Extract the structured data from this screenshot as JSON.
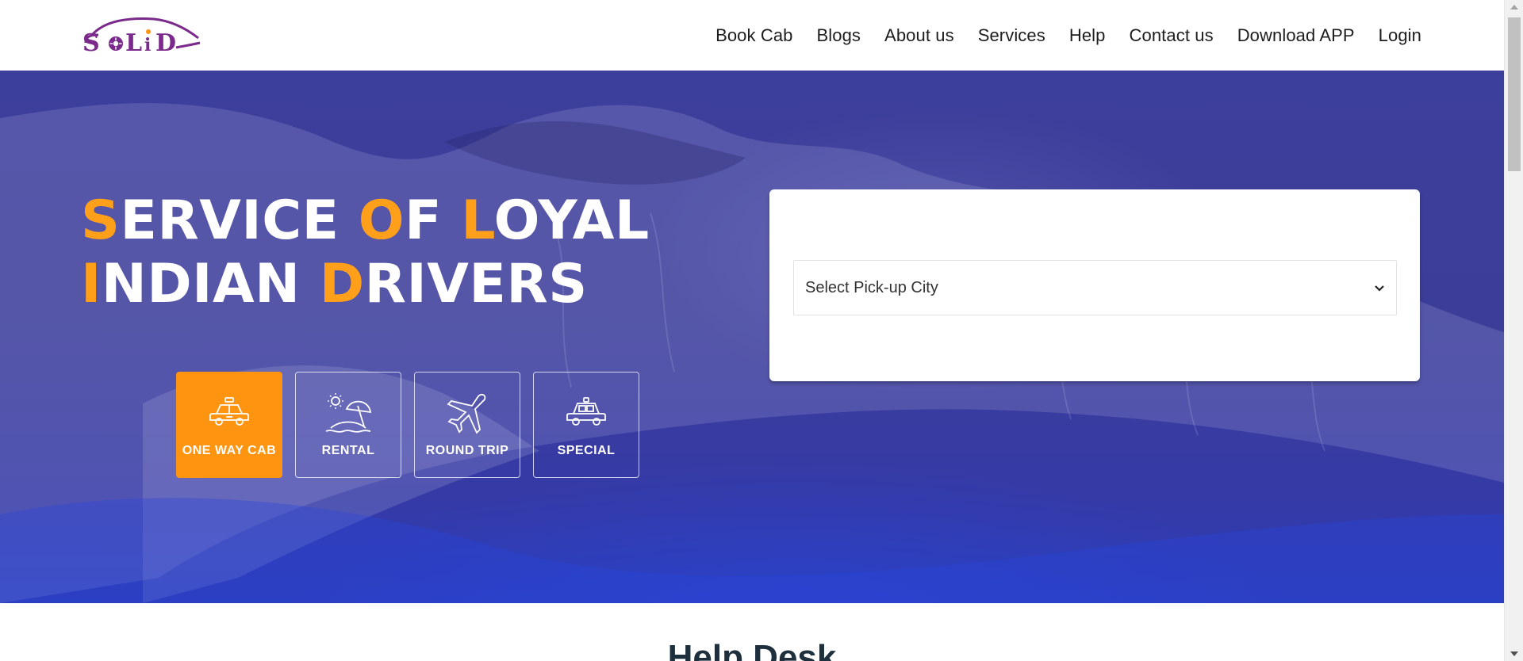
{
  "brand": {
    "logo_text": "SoLiD",
    "accent_color": "#ff9410",
    "brand_purple": "#7a2a8a"
  },
  "nav": {
    "items": [
      {
        "label": "Book Cab"
      },
      {
        "label": "Blogs"
      },
      {
        "label": "About us"
      },
      {
        "label": "Services"
      },
      {
        "label": "Help"
      },
      {
        "label": "Contact us"
      },
      {
        "label": "Download APP"
      },
      {
        "label": "Login"
      }
    ]
  },
  "hero": {
    "title": {
      "line1": [
        {
          "accent": "S",
          "rest": "ERVICE "
        },
        {
          "accent": "O",
          "rest": "F "
        },
        {
          "accent": "L",
          "rest": "OYAL"
        }
      ],
      "line2": [
        {
          "accent": "I",
          "rest": "NDIAN "
        },
        {
          "accent": "D",
          "rest": "RIVERS"
        }
      ]
    },
    "trip_types": [
      {
        "label": "ONE WAY CAB",
        "icon": "taxi-icon",
        "active": true
      },
      {
        "label": "RENTAL",
        "icon": "beach-umbrella-icon",
        "active": false
      },
      {
        "label": "ROUND TRIP",
        "icon": "airplane-icon",
        "active": false
      },
      {
        "label": "SPECIAL",
        "icon": "car-icon",
        "active": false
      }
    ],
    "hero_color": "#3a3e9a"
  },
  "booking": {
    "pickup_select": {
      "value": "Select Pick-up City",
      "icon": "chevron-down-icon"
    }
  },
  "sections": {
    "help_desk_title": "Help Desk"
  }
}
